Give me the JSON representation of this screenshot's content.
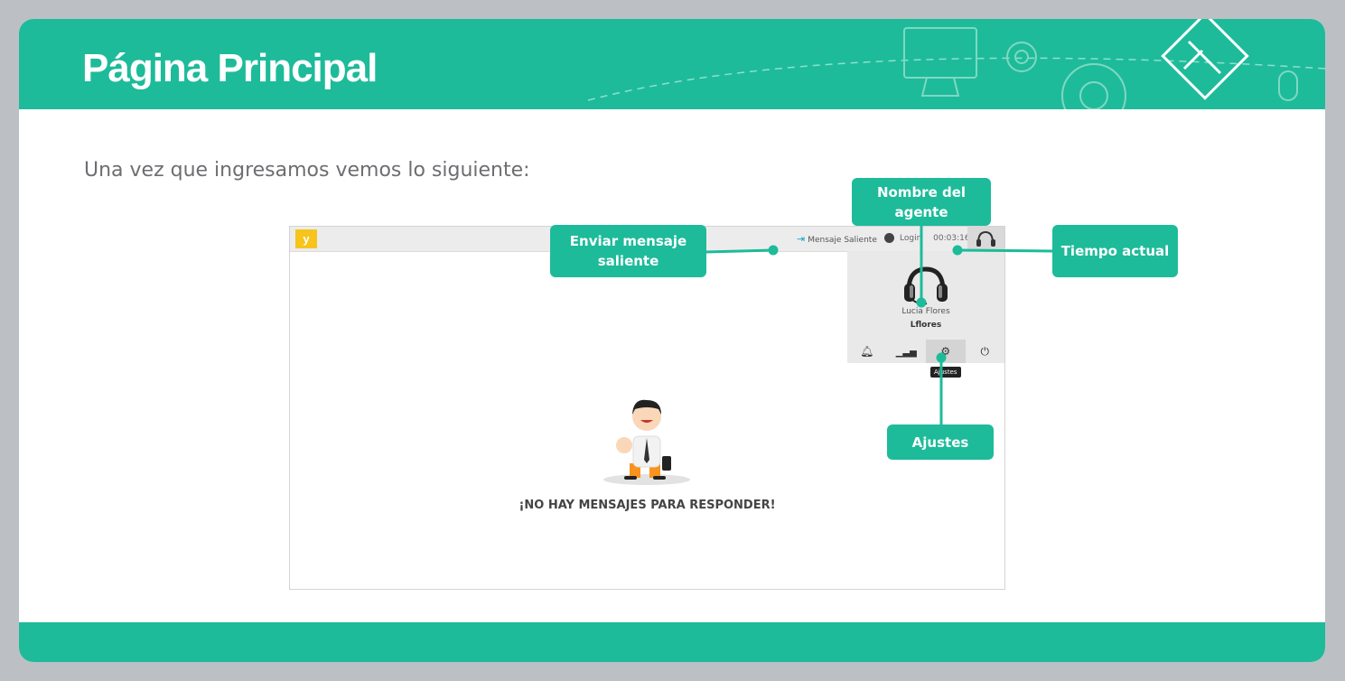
{
  "slide": {
    "title": "Página Principal",
    "intro": "Una vez que ingresamos vemos lo siguiente:"
  },
  "app": {
    "logo": "y",
    "send_message": "Mensaje Saliente",
    "login_label": "Login",
    "timer": "00:03:16",
    "agent_name": "Lucia Flores",
    "agent_user": "Lflores",
    "tooltip": "Ajustes",
    "empty_message": "¡NO HAY MENSAJES PARA RESPONDER!",
    "panel_icons": [
      "bell-icon",
      "chart-icon",
      "gear-icon",
      "power-icon"
    ]
  },
  "callouts": {
    "send": "Enviar mensaje saliente",
    "agent": "Nombre del agente",
    "time": "Tiempo actual",
    "settings": "Ajustes"
  },
  "colors": {
    "accent": "#1dbb9a",
    "logo": "#f6c41b",
    "background": "#bcc0c4"
  }
}
